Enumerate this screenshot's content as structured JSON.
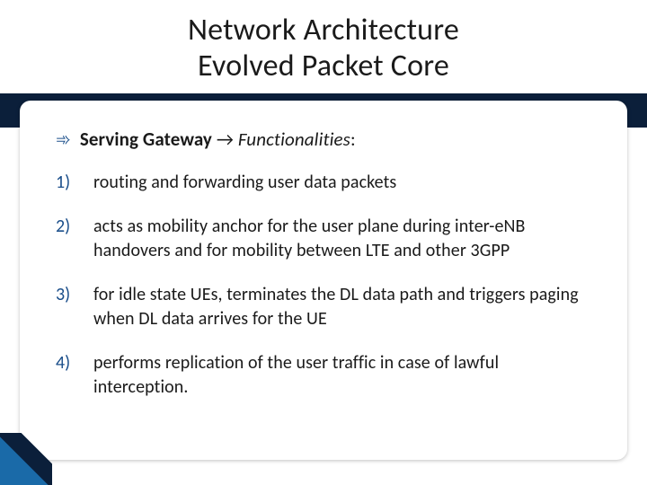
{
  "title": {
    "line1": "Network Architecture",
    "line2": "Evolved Packet Core"
  },
  "subtitle": {
    "arrow_glyph": "➾",
    "bold_text": "Serving Gateway",
    "inline_arrow": "→",
    "italic_text": "Functionalities",
    "colon": ":"
  },
  "items": [
    {
      "num": "1)",
      "text": "routing and forwarding user data packets"
    },
    {
      "num": "2)",
      "text": "acts as mobility anchor for the user plane during inter-eNB handovers and for mobility between LTE and other 3GPP"
    },
    {
      "num": "3)",
      "text": "for idle state UEs, terminates the DL data path and triggers paging when DL data arrives for the UE"
    },
    {
      "num": "4)",
      "text": "performs replication of the user traffic in case of lawful interception."
    }
  ]
}
